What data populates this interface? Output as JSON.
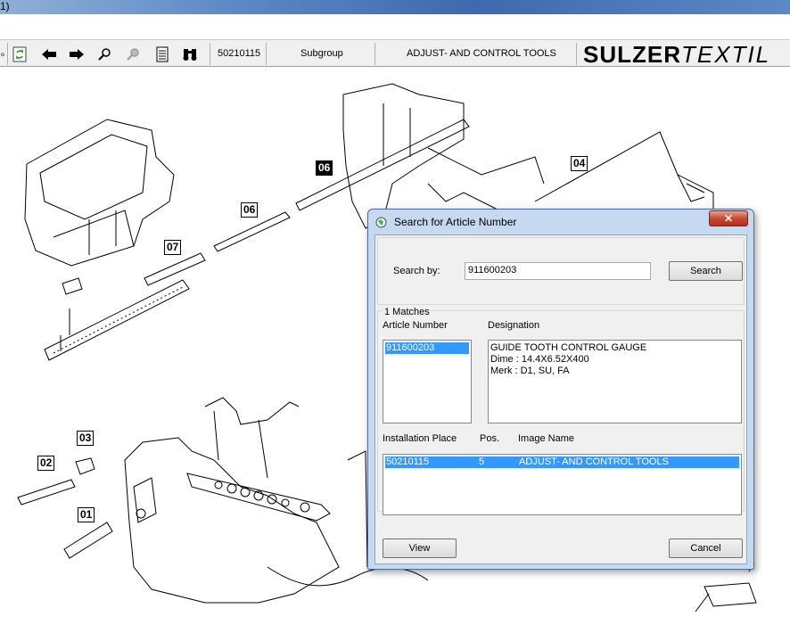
{
  "app": {
    "title_fragment": "1)"
  },
  "toolbar": {
    "part_number": "50210115",
    "level": "Subgroup",
    "group_name": "ADJUST- AND CONTROL TOOLS",
    "logo_bold": "SULZER",
    "logo_light": "TEXTIL"
  },
  "drawing": {
    "callouts": [
      "06",
      "04",
      "06",
      "07",
      "03",
      "02",
      "01"
    ]
  },
  "dialog": {
    "title": "Search for Article Number",
    "close_glyph": "✕",
    "search_label": "Search by:",
    "search_value": "911600203",
    "search_button": "Search",
    "matches_label": "1 Matches",
    "col_article": "Article Number",
    "col_designation": "Designation",
    "articles": [
      "911600203"
    ],
    "designation_lines": [
      "GUIDE TOOTH CONTROL GAUGE",
      "Dime : 14.4X6.52X400",
      "Merk : D1, SU, FA"
    ],
    "col_install": "Installation Place",
    "col_pos": "Pos.",
    "col_image": "Image Name",
    "install_rows": [
      {
        "place": "50210115",
        "pos": "5",
        "image": "ADJUST- AND CONTROL TOOLS"
      }
    ],
    "view_button": "View",
    "cancel_button": "Cancel"
  }
}
